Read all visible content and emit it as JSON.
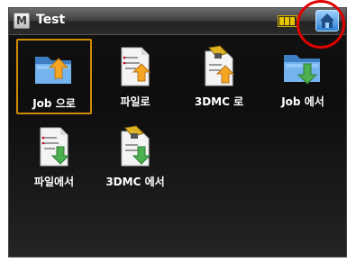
{
  "window": {
    "title": "Test",
    "app_icon_letter": "M"
  },
  "status": {
    "battery_icon": "battery-icon",
    "home_icon": "home-icon"
  },
  "tiles": [
    {
      "label": "Job 으로",
      "icon": "folder-import-icon",
      "selected": true
    },
    {
      "label": "파일로",
      "icon": "file-import-icon",
      "selected": false
    },
    {
      "label": "3DMC 로",
      "icon": "3dmc-import-icon",
      "selected": false
    },
    {
      "label": "Job 에서",
      "icon": "folder-export-icon",
      "selected": false
    },
    {
      "label": "파일에서",
      "icon": "file-export-icon",
      "selected": false
    },
    {
      "label": "3DMC 에서",
      "icon": "3dmc-export-icon",
      "selected": false
    }
  ],
  "colors": {
    "selection_border": "#d28b00",
    "highlight_ring": "#e00000",
    "home_button": "#2d7fd4"
  }
}
